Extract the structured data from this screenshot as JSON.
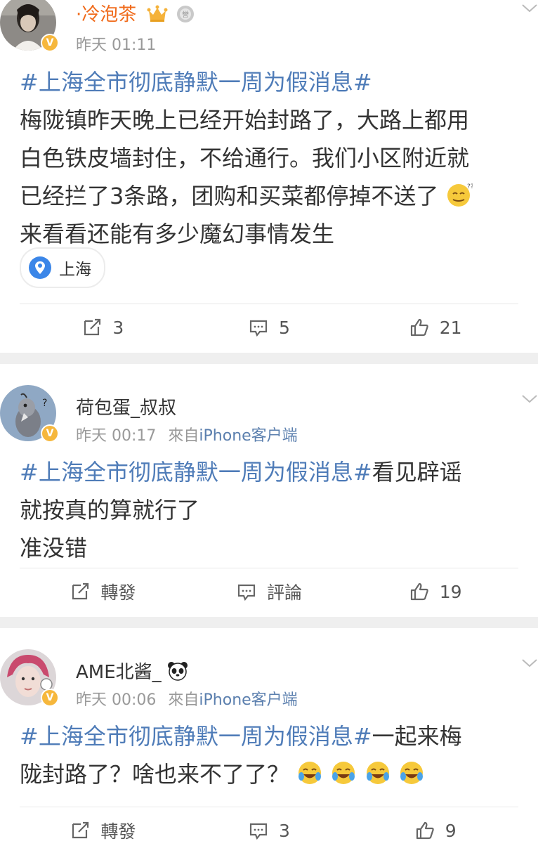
{
  "posts": [
    {
      "username": "·冷泡茶",
      "time": "昨天 01:11",
      "source_prefix": "",
      "source": "",
      "topic": "#上海全市彻底静默一周为假消息#",
      "lines": [
        "梅陇镇昨天晚上已经开始封路了，大路上都用",
        "白色铁皮墙封住，不给通行。我们小区附近就",
        "已经拦了3条路，团购和买菜都停掉不送了",
        "来看看还能有多少魔幻事情发生"
      ],
      "location": "上海",
      "repost": "3",
      "comment": "5",
      "like": "21"
    },
    {
      "username": "荷包蛋_叔叔",
      "time": "昨天 00:17",
      "source_prefix": "來自",
      "source": "iPhone客户端",
      "topic": "#上海全市彻底静默一周为假消息#",
      "topic_tail": "看见辟谣",
      "lines": [
        "就按真的算就行了",
        "准没错"
      ],
      "repost": "轉發",
      "comment": "評論",
      "like": "19"
    },
    {
      "username": "AME北酱_",
      "time": "昨天 00:06",
      "source_prefix": "來自",
      "source": "iPhone客户端",
      "topic": "#上海全市彻底静默一周为假消息#",
      "topic_tail": "一起来梅",
      "lines": [
        "陇封路了？啥也来不了了？"
      ],
      "repost": "轉發",
      "comment": "3",
      "like": "9"
    }
  ],
  "colors": {
    "topic": "#4f7cb8",
    "username_vip": "#f06a1a",
    "badge": "#f6b73c"
  }
}
